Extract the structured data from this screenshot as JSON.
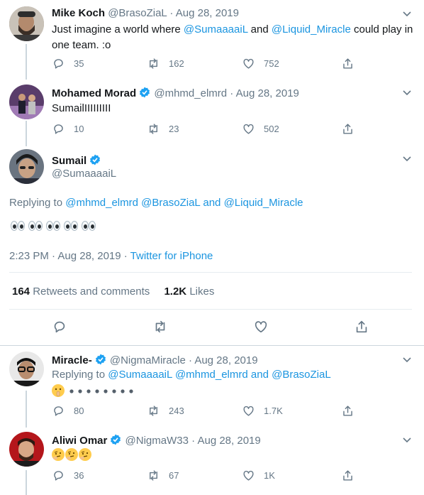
{
  "tweets": [
    {
      "name": "Mike Koch",
      "handle": "@BrasoZiaL",
      "date": "Aug 28, 2019",
      "text_parts": [
        "Just imagine a world where ",
        "@SumaaaaiL",
        " and ",
        "@Liquid_Miracle",
        " could play in",
        "one team. :o"
      ],
      "replies": "35",
      "retweets": "162",
      "likes": "752"
    },
    {
      "name": "Mohamed Morad",
      "handle": "@mhmd_elmrd",
      "date": "Aug 28, 2019",
      "text": "SumailIIIIIIIII",
      "replies": "10",
      "retweets": "23",
      "likes": "502"
    }
  ],
  "focused": {
    "name": "Sumail",
    "handle": "@SumaaaaiL",
    "replying_prefix": "Replying to ",
    "replying_to": [
      "@mhmd_elmrd",
      "@BrasoZiaL",
      "@Liquid_Miracle"
    ],
    "replying_and": " and ",
    "timestamp": "2:23 PM · Aug 28, 2019 · ",
    "source": "Twitter for iPhone",
    "retweets_count": "164",
    "retweets_label": "Retweets and comments",
    "likes_count": "1.2K",
    "likes_label": "Likes"
  },
  "replies": [
    {
      "name": "Miracle-",
      "handle": "@NigmaMiracle",
      "date": "Aug 28, 2019",
      "replying_prefix": "Replying to ",
      "replying_to": [
        "@SumaaaaiL",
        "@mhmd_elmrd",
        "@BrasoZiaL"
      ],
      "replying_and": " and ",
      "replies": "80",
      "retweets": "243",
      "likes": "1.7K"
    },
    {
      "name": "Aliwi Omar",
      "handle": "@NigmaW33",
      "date": "Aug 28, 2019",
      "replies": "36",
      "retweets": "67",
      "likes": "1K"
    }
  ],
  "separator": " · ",
  "colors": {
    "link": "#1b95e0",
    "muted": "#657786",
    "verified": "#1da1f2"
  }
}
